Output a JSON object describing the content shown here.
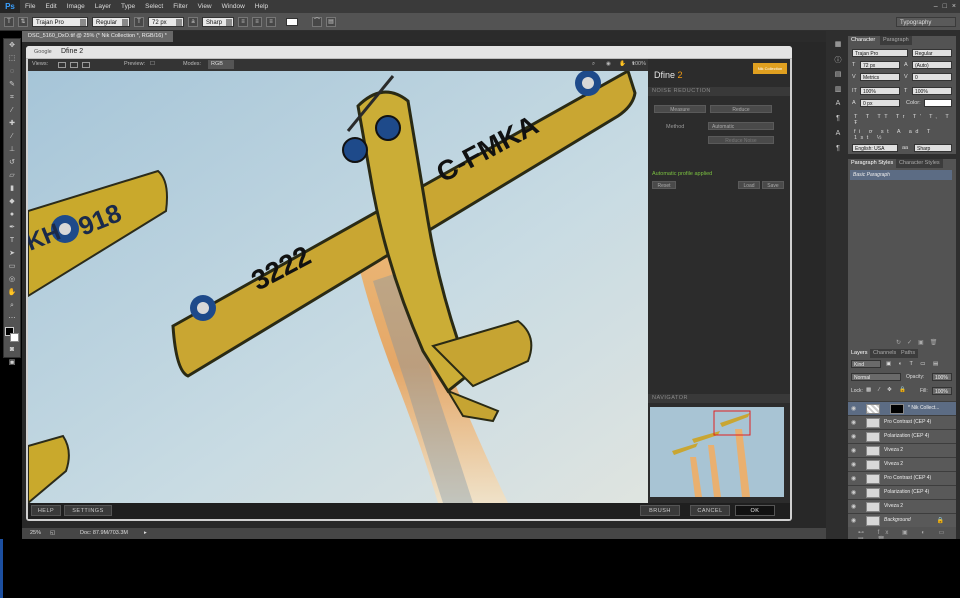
{
  "app": {
    "logo": "Ps"
  },
  "menubar": {
    "items": [
      "File",
      "Edit",
      "Image",
      "Layer",
      "Type",
      "Select",
      "Filter",
      "View",
      "Window",
      "Help"
    ]
  },
  "window_controls": [
    "minimize-icon",
    "restore-icon",
    "close-icon"
  ],
  "optionsbar": {
    "font_family": "Trajan Pro",
    "font_style": "Regular",
    "font_size": "72 px",
    "antialias": "Sharp",
    "workspace": "Typography"
  },
  "document_tab": {
    "title": "DSC_5160_DxO.tif @ 25% (* Nik Collection *, RGB/16) *"
  },
  "dfine": {
    "google_label": "Google",
    "window_title": "Dfine 2",
    "views_label": "Views:",
    "preview_label": "Preview:",
    "modes_label": "Modes:",
    "mode_value": "RGB",
    "zoom_value": "100%",
    "panel_title_a": "Dfine",
    "panel_title_b": "2",
    "logo_text": "Nik Collection",
    "section_noise": "NOISE REDUCTION",
    "tab_measure": "Measure",
    "tab_reduce": "Reduce",
    "method_label": "Method",
    "method_value": "Automatic",
    "reduce_noise_btn": "Reduce Noise",
    "auto_msg": "Automatic profile applied",
    "reset_btn": "Reset",
    "load_btn": "Load",
    "save_btn": "Save",
    "navigator_label": "NAVIGATOR",
    "help_btn": "HELP",
    "settings_btn": "SETTINGS",
    "brush_btn": "BRUSH",
    "cancel_btn": "CANCEL",
    "ok_btn": "OK"
  },
  "photo_text": {
    "reg1": "C-FMKA",
    "num1": "3222",
    "num2": "918",
    "reg_left": "KH"
  },
  "statusbar": {
    "zoom": "25%",
    "doc": "Doc: 87.9M/703.3M"
  },
  "character_panel": {
    "tab1": "Character",
    "tab2": "Paragraph",
    "font_family": "Trajan Pro",
    "font_style": "Regular",
    "font_size": "72 px",
    "leading": "(Auto)",
    "kerning": "Metrics",
    "tracking": "0",
    "vscale": "100%",
    "hscale": "100%",
    "baseline": "0 px",
    "color_label": "Color:",
    "language": "English: USA",
    "antialias": "Sharp"
  },
  "styles_panel": {
    "tab1": "Paragraph Styles",
    "tab2": "Character Styles",
    "item": "Basic Paragraph"
  },
  "layers_panel": {
    "tab1": "Layers",
    "tab2": "Channels",
    "tab3": "Paths",
    "kind": "Kind",
    "blend": "Normal",
    "opacity_label": "Opacity:",
    "opacity": "100%",
    "lock_label": "Lock:",
    "fill_label": "Fill:",
    "fill": "100%",
    "layers": [
      "* Nik Collect...",
      "Pro Contrast (CEP 4)",
      "Polarization (CEP 4)",
      "Viveza 2",
      "Viveza 2",
      "Pro Contrast (CEP 4)",
      "Polarization (CEP 4)",
      "Viveza 2",
      "Background"
    ]
  }
}
